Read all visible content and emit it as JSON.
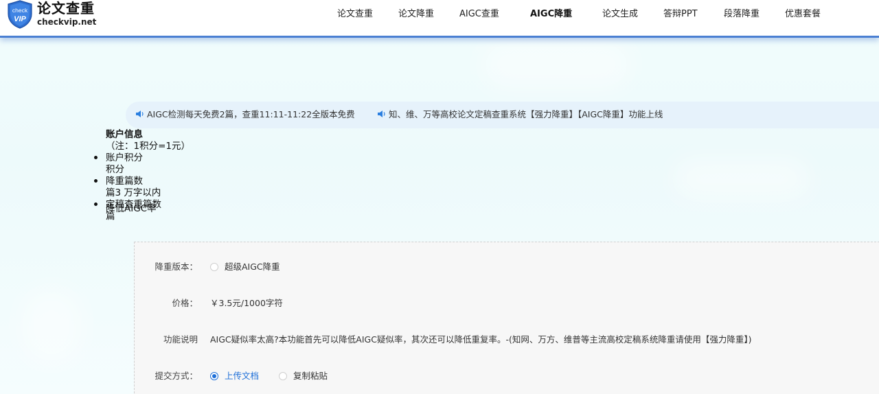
{
  "header": {
    "logo_badge_top": "check",
    "logo_badge_bottom": "VIP",
    "logo_title": "论文查重",
    "logo_domain": "checkvip.net",
    "border_color": "#4a7fd2"
  },
  "nav": {
    "items": [
      {
        "label": "论文查重",
        "active": false
      },
      {
        "label": "论文降重",
        "active": false
      },
      {
        "label": "AIGC查重",
        "active": false
      },
      {
        "label": "AIGC降重",
        "active": true
      },
      {
        "label": "论文生成",
        "active": false
      },
      {
        "label": "答辩PPT",
        "active": false
      },
      {
        "label": "段落降重",
        "active": false
      },
      {
        "label": "优惠套餐",
        "active": false
      }
    ]
  },
  "notice": {
    "items": [
      {
        "icon": "speaker-icon",
        "text": "AIGC检测每天免费2篇，查重11:11-11:22全版本免费"
      },
      {
        "icon": "speaker-icon",
        "text": "知、维、万等高校论文定稿查重系统【强力降重】【AIGC降重】功能上线"
      }
    ],
    "icon_color": "#2b7fe0"
  },
  "account": {
    "title": "账户信息",
    "note": "（注：1积分=1元）",
    "points_label": "账户积分",
    "points_unit": "积分",
    "reduce_label": "降重篇数",
    "reduce_unit": "篇3 万字以内",
    "final_label": "定稿查重篇数",
    "final_overlap": "降低AIGC率",
    "final_unit": "篇"
  },
  "form": {
    "version_label": "降重版本：",
    "version_option": "超级AIGC降重",
    "price_label": "价格：",
    "price_value": "￥3.5元/1000字符",
    "desc_label": "功能说明",
    "desc_value": "AIGC疑似率太高?本功能首先可以降低AIGC疑似率，其次还可以降低重复率。-(知网、万方、维普等主流高校定稿系统降重请使用【强力降重】)",
    "submit_label": "提交方式：",
    "submit_options": [
      {
        "label": "上传文档",
        "checked": true
      },
      {
        "label": "复制粘贴",
        "checked": false
      }
    ],
    "accent_color": "#1e6fd8"
  }
}
